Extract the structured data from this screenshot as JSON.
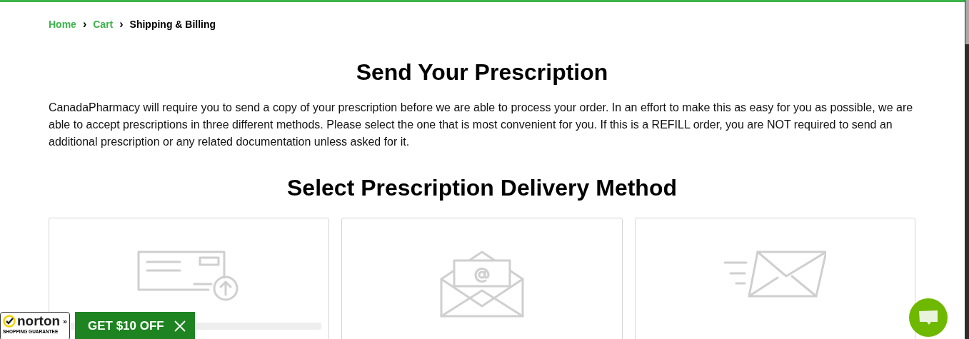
{
  "breadcrumb": [
    {
      "label": "Home",
      "current": false
    },
    {
      "label": "Cart",
      "current": false
    },
    {
      "label": "Shipping & Billing",
      "current": true
    }
  ],
  "separator": "›",
  "title": "Send Your Prescription",
  "intro": "CanadaPharmacy will require you to send a copy of your prescription before we are able to process your order. In an effort to make this as easy for you as possible, we are able to accept prescriptions in three different methods. Please select the one that is most convenient for you. If this is a REFILL order, you are NOT required to send an additional prescription or any related documentation unless asked for it.",
  "subtitle": "Select Prescription Delivery Method",
  "methods": [
    {
      "kind": "upload"
    },
    {
      "kind": "email"
    },
    {
      "kind": "mail"
    }
  ],
  "norton": {
    "brand": "norton",
    "tagline": "SHOPPING GUARANTEE",
    "chevron": "»"
  },
  "coupon": {
    "label": "GET $10 OFF"
  }
}
